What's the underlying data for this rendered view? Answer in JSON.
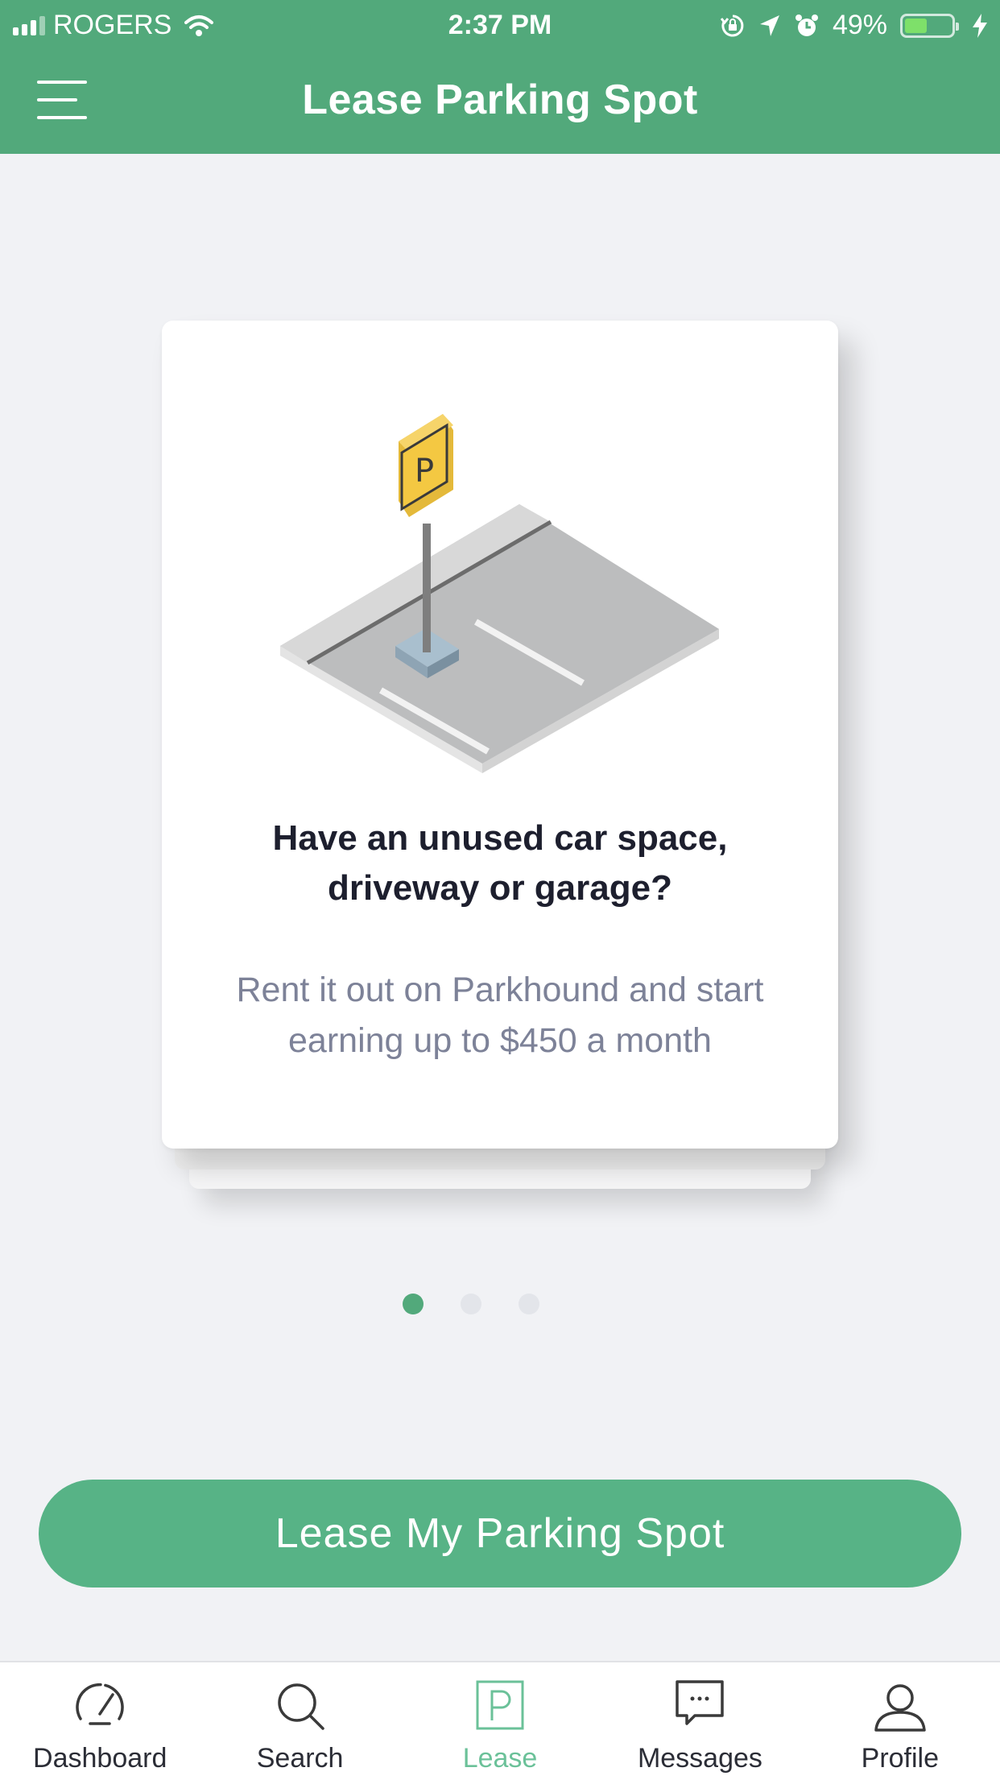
{
  "status_bar": {
    "carrier": "ROGERS",
    "time": "2:37 PM",
    "battery_percent": "49%",
    "battery_level": 0.49,
    "icons": [
      "signal-icon",
      "wifi-icon",
      "orientation-lock-icon",
      "location-arrow-icon",
      "alarm-icon",
      "battery-icon",
      "charging-bolt-icon"
    ]
  },
  "header": {
    "title": "Lease Parking Spot",
    "menu_icon": "hamburger-menu-icon"
  },
  "card": {
    "illustration": "parking-spot-illustration",
    "sign_letter": "P",
    "title": "Have an unused car space, driveway or garage?",
    "text": "Rent it out on Parkhound and start earning up to $450 a month"
  },
  "pager": {
    "count": 3,
    "active_index": 0
  },
  "cta": {
    "label": "Lease My Parking Spot"
  },
  "tabbar": {
    "active": "Lease",
    "tabs": [
      {
        "label": "Dashboard",
        "icon": "speedometer-icon"
      },
      {
        "label": "Search",
        "icon": "search-icon"
      },
      {
        "label": "Lease",
        "icon": "parking-icon"
      },
      {
        "label": "Messages",
        "icon": "chat-bubble-icon"
      },
      {
        "label": "Profile",
        "icon": "user-icon"
      }
    ]
  },
  "colors": {
    "brand_green": "#52a97b",
    "button_green": "#57b386",
    "active_tab": "#6bc199",
    "background": "#f1f2f5"
  }
}
